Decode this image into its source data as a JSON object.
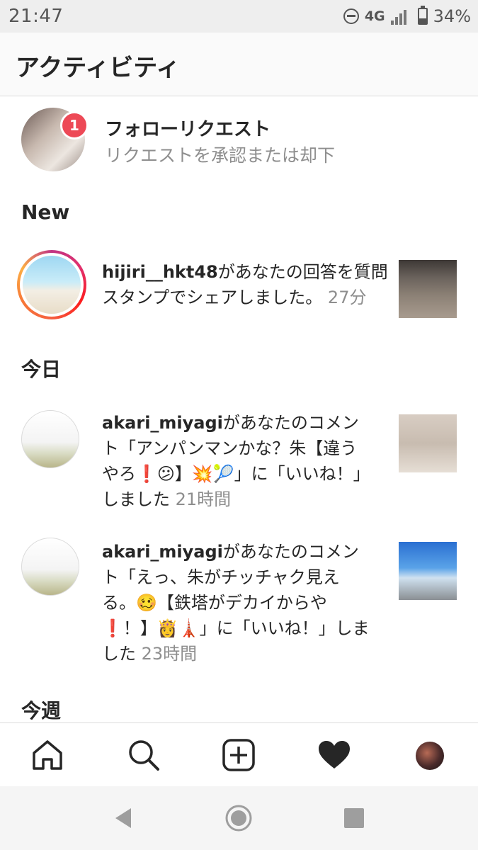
{
  "status_bar": {
    "time": "21:47",
    "network": "4G",
    "battery": "34%",
    "battery_level": 0.34,
    "icons": [
      "do-not-disturb-icon",
      "signal-icon",
      "battery-icon"
    ]
  },
  "header": {
    "title": "アクティビティ"
  },
  "follow_request": {
    "title": "フォローリクエスト",
    "subtitle": "リクエストを承認または却下",
    "badge_count": "1"
  },
  "sections": {
    "new": "New",
    "today": "今日",
    "this_week": "今週"
  },
  "items": [
    {
      "username": "hijiri__hkt48",
      "text": "があなたの回答を質問スタンプでシェアしました。",
      "time": "27分"
    },
    {
      "username": "akari_miyagi",
      "text": "があなたのコメント「アンパンマンかな？朱【違うやろ❗😕】💥🎾」に「いいね！」しました",
      "time": "21時間"
    },
    {
      "username": "akari_miyagi",
      "text": "があなたのコメント「えっ、朱がチッチャク見える。🥴【鉄塔がデカイからや❗！】👸🗼」に「いいね！」しました",
      "time": "23時間"
    }
  ],
  "bottom_nav": [
    "home-icon",
    "search-icon",
    "add-post-icon",
    "activity-heart-icon",
    "profile-avatar"
  ],
  "android_nav": [
    "back-icon",
    "home-circle-icon",
    "recents-icon"
  ],
  "colors": {
    "badge": "#ed4956",
    "secondary_text": "#8e8e8e",
    "primary_text": "#262626"
  }
}
